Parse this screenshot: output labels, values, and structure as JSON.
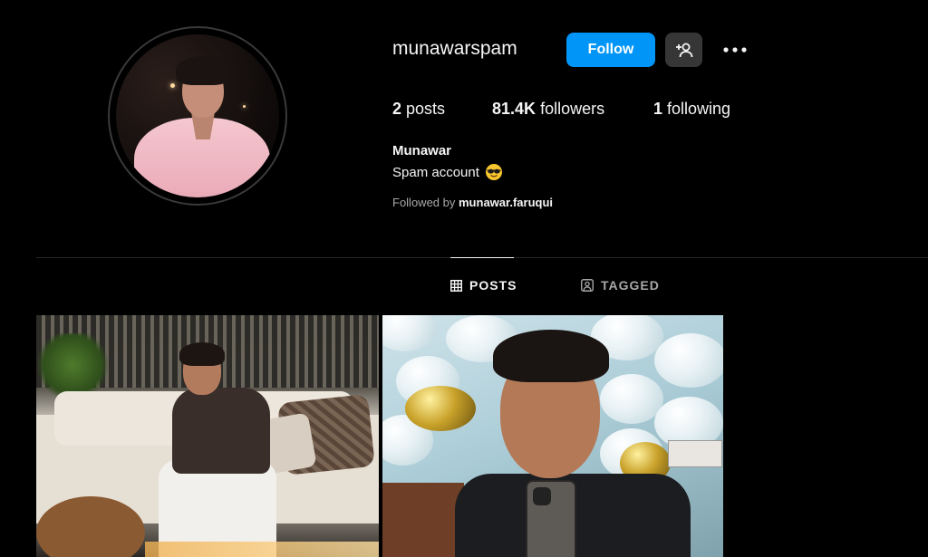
{
  "profile": {
    "username": "munawarspam",
    "follow_label": "Follow",
    "suggest_icon": "person-add-icon",
    "more_icon": "more-horizontal-icon",
    "posts_count": "2",
    "posts_label": "posts",
    "followers_count": "81.4K",
    "followers_label": "followers",
    "following_count": "1",
    "following_label": "following",
    "full_name": "Munawar",
    "bio": "Spam account",
    "bio_emoji": "smiling-face-with-sunglasses",
    "followed_by_prefix": "Followed by",
    "followed_by_user": "munawar.faruqui"
  },
  "tabs": [
    {
      "label": "POSTS",
      "icon": "grid-icon",
      "active": true
    },
    {
      "label": "TAGGED",
      "icon": "tagged-icon",
      "active": false
    }
  ],
  "colors": {
    "background": "#000000",
    "follow_button": "#0095f6",
    "secondary_button": "#363636",
    "muted_text": "#a8a8a8"
  }
}
